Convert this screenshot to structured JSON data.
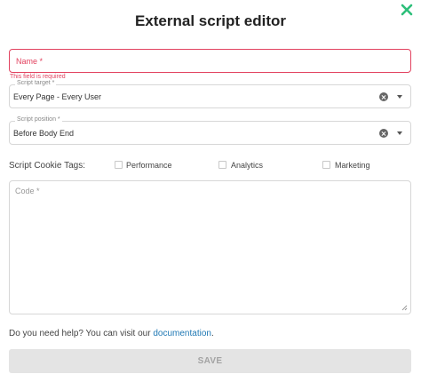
{
  "dialog": {
    "title": "External script editor"
  },
  "name_field": {
    "label": "Name *",
    "error": "This field is required"
  },
  "script_target": {
    "label": "Script target *",
    "value": "Every Page - Every User"
  },
  "script_position": {
    "label": "Script position *",
    "value": "Before Body End"
  },
  "cookie_tags": {
    "label": "Script Cookie Tags:",
    "options": [
      {
        "label": "Performance",
        "checked": false
      },
      {
        "label": "Analytics",
        "checked": false
      },
      {
        "label": "Marketing",
        "checked": false
      }
    ]
  },
  "code_field": {
    "label": "Code *"
  },
  "help": {
    "prefix": "Do you need help? You can visit our ",
    "link": "documentation",
    "suffix": "."
  },
  "save_button": {
    "label": "SAVE"
  },
  "colors": {
    "accent": "#2dbf7a",
    "error": "#e2425f",
    "link": "#1f78b4",
    "disabled_bg": "#e4e4e4"
  }
}
